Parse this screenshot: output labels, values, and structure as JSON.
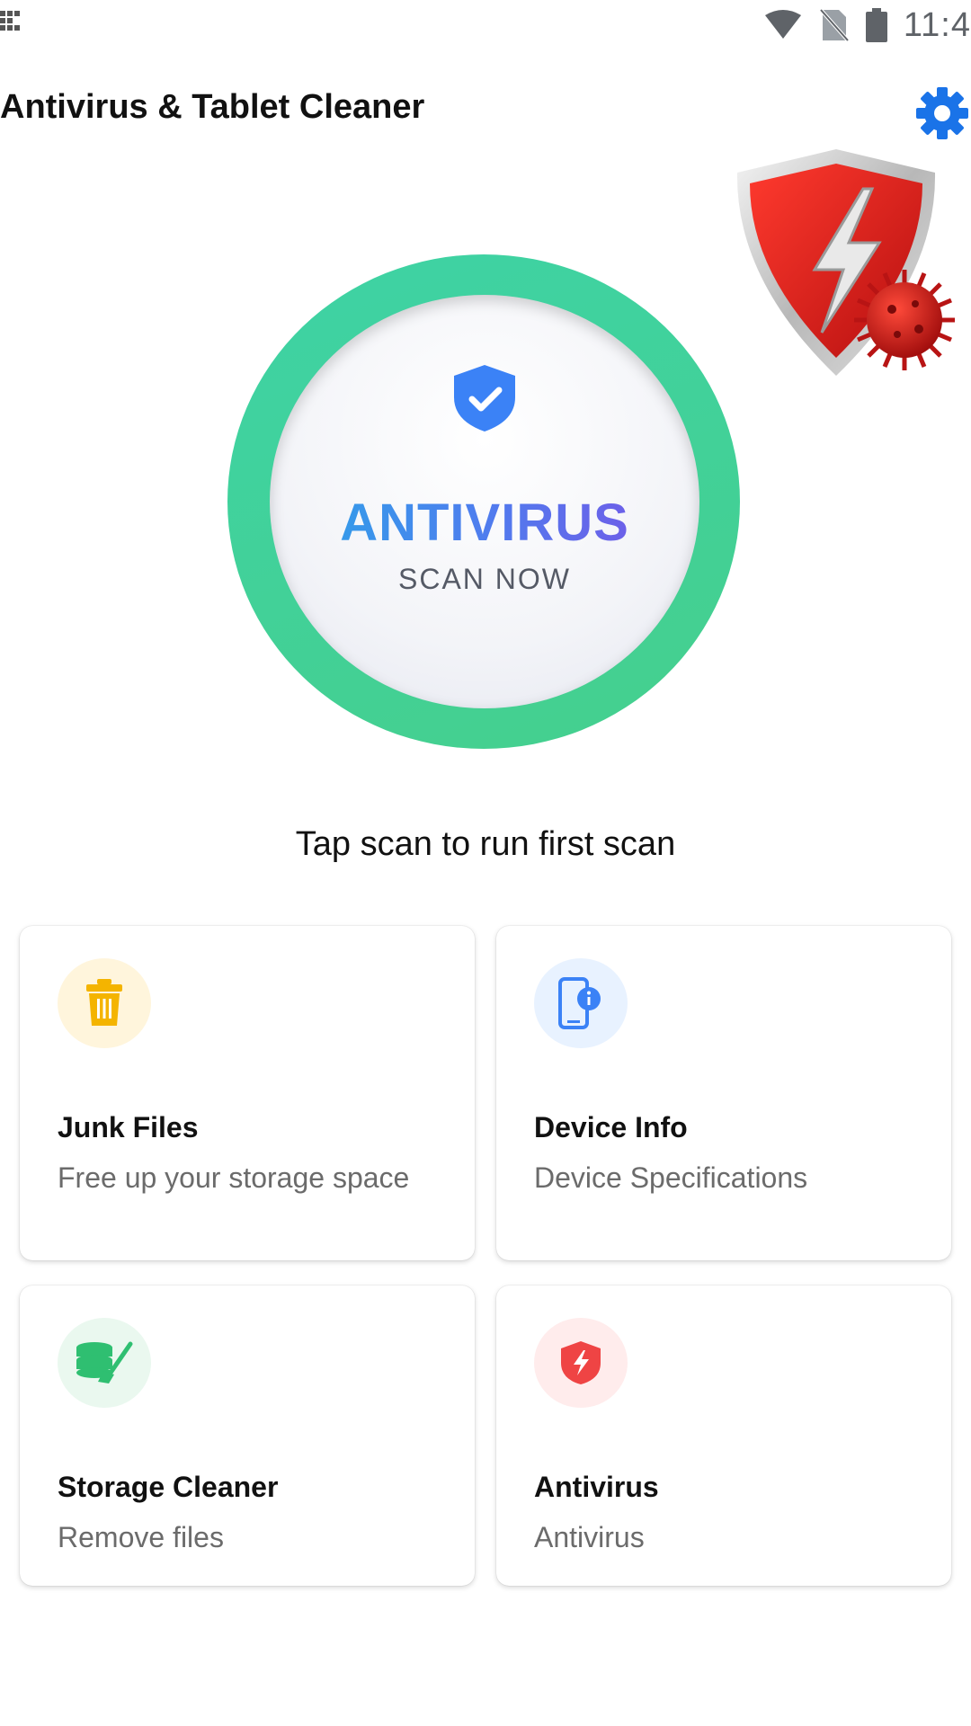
{
  "status_bar": {
    "time": "11:4"
  },
  "app": {
    "title": "Antivirus & Tablet Cleaner"
  },
  "scan": {
    "title": "ANTIVIRUS",
    "subtitle": "SCAN NOW"
  },
  "hint": "Tap scan to run first scan",
  "cards": [
    {
      "title": "Junk Files",
      "subtitle": "Free up your storage space",
      "icon": "trash-icon",
      "icon_bg": "#fff5dc",
      "icon_color": "#f4b400"
    },
    {
      "title": "Device Info",
      "subtitle": "Device Specifications",
      "icon": "phone-info-icon",
      "icon_bg": "#e8f2ff",
      "icon_color": "#3b82f6"
    },
    {
      "title": "Storage Cleaner",
      "subtitle": "Remove files",
      "icon": "storage-clean-icon",
      "icon_bg": "#eaf8ef",
      "icon_color": "#2fbf71"
    },
    {
      "title": "Antivirus",
      "subtitle": "Antivirus",
      "icon": "shield-bolt-icon",
      "icon_bg": "#ffecec",
      "icon_color": "#ef4444"
    }
  ],
  "colors": {
    "accent": "#1a73e8",
    "ring": "#3fd19a"
  }
}
